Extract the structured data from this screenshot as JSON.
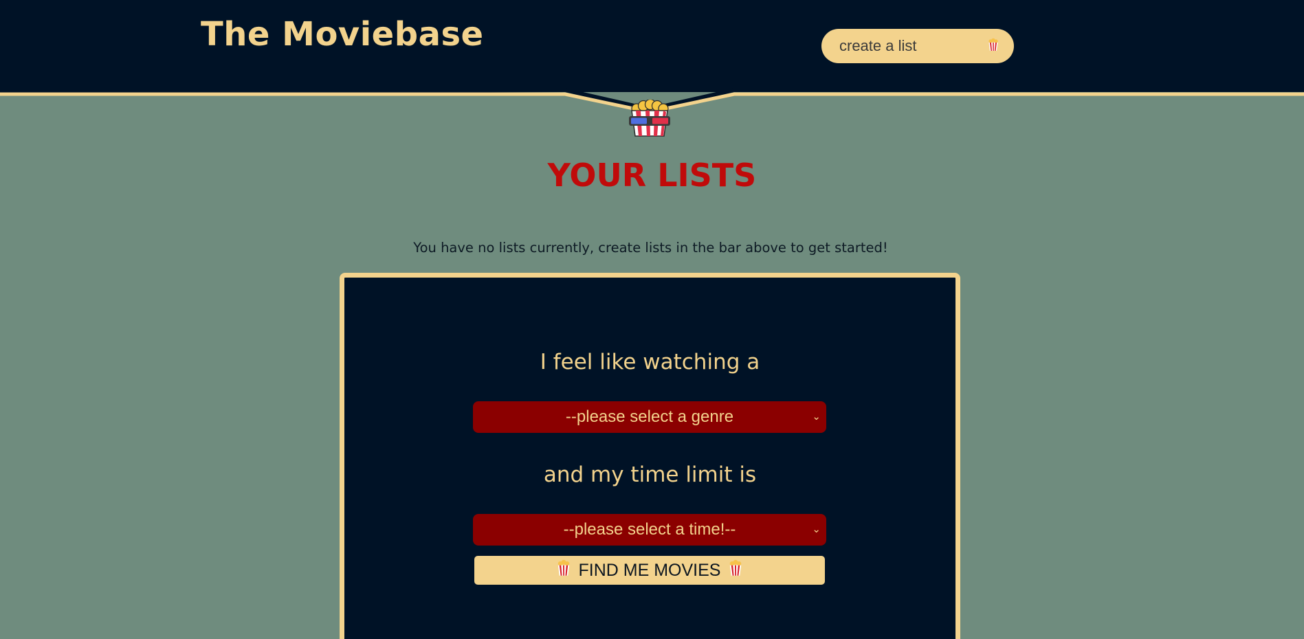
{
  "header": {
    "title": "The Moviebase",
    "create_list_placeholder": "create a list",
    "create_list_icon": "popcorn-icon"
  },
  "mascot": {
    "icon": "popcorn-3d-glasses-icon"
  },
  "lists": {
    "heading": "YOUR LISTS",
    "empty_message": "You have no lists currently, create lists in the bar above to get started!"
  },
  "finder": {
    "prompt_genre": "I feel like watching a",
    "genre_select_value": "--please select a genre",
    "prompt_time": "and my time limit is",
    "time_select_value": "--please select a time!--",
    "find_button_label": "FIND ME MOVIES"
  },
  "colors": {
    "background": "#6f8c7e",
    "navy": "#001226",
    "gold": "#f3d38d",
    "red_heading": "#c00a0a",
    "select_red": "#8b0000"
  }
}
